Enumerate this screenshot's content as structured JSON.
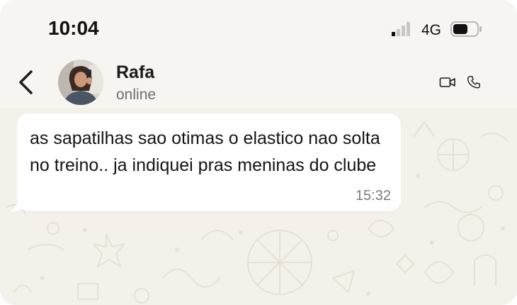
{
  "status_bar": {
    "time": "10:04",
    "network": "4G",
    "signal_icon": "signal-bars-icon",
    "battery_icon": "battery-icon"
  },
  "header": {
    "back_icon": "chevron-left-icon",
    "contact_name": "Rafa",
    "contact_status": "online",
    "video_icon": "video-camera-icon",
    "call_icon": "phone-icon"
  },
  "messages": [
    {
      "direction": "incoming",
      "text": "as sapatilhas sao otimas o elastico nao solta no treino.. ja indiquei pras meninas do clube",
      "time": "15:32"
    }
  ],
  "colors": {
    "chat_background": "#f4f1ea",
    "bubble": "#ffffff",
    "text": "#141414",
    "secondary_text": "#6e6e6e"
  }
}
